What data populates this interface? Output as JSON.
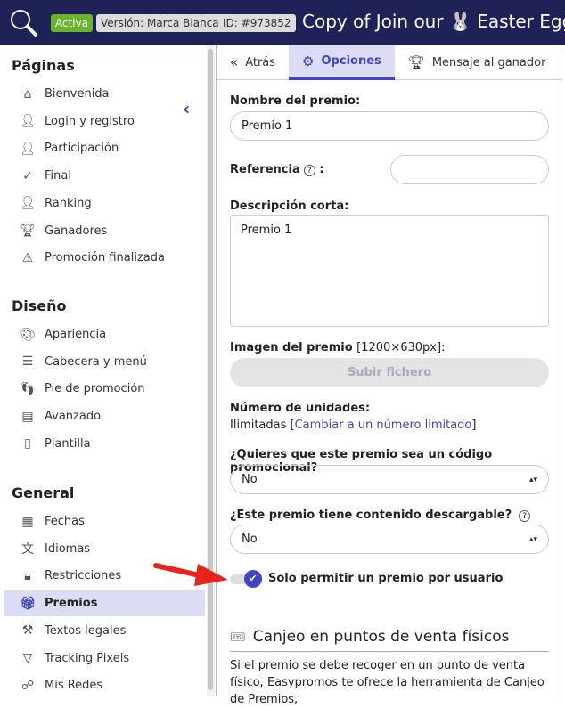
{
  "header": {
    "status": "Activa",
    "version_label": "Versión:",
    "version": "Marca Blanca",
    "id_label": "ID:",
    "id": "#973852",
    "title": "Copy of Join our 🐰 Easter Egg",
    "bg": "#1f2257"
  },
  "sidebar": {
    "sections": [
      {
        "title": "Páginas",
        "items": [
          {
            "label": "Bienvenida",
            "icon": "home-icon"
          },
          {
            "label": "Login y registro",
            "icon": "user-gear-icon"
          },
          {
            "label": "Participación",
            "icon": "user-plus-icon"
          },
          {
            "label": "Final",
            "icon": "check-icon"
          },
          {
            "label": "Ranking",
            "icon": "ranking-icon"
          },
          {
            "label": "Ganadores",
            "icon": "trophy-icon"
          },
          {
            "label": "Promoción finalizada",
            "icon": "warning-icon"
          }
        ]
      },
      {
        "title": "Diseño",
        "items": [
          {
            "label": "Apariencia",
            "icon": "palette-icon"
          },
          {
            "label": "Cabecera y menú",
            "icon": "menu-icon"
          },
          {
            "label": "Pie de promoción",
            "icon": "footprint-icon"
          },
          {
            "label": "Avanzado",
            "icon": "code-icon"
          },
          {
            "label": "Plantilla",
            "icon": "file-icon"
          }
        ]
      },
      {
        "title": "General",
        "items": [
          {
            "label": "Fechas",
            "icon": "calendar-icon"
          },
          {
            "label": "Idiomas",
            "icon": "language-icon"
          },
          {
            "label": "Restricciones",
            "icon": "lock-icon"
          },
          {
            "label": "Premios",
            "icon": "gift-icon",
            "active": true
          },
          {
            "label": "Textos legales",
            "icon": "gavel-icon"
          },
          {
            "label": "Tracking Pixels",
            "icon": "filter-icon"
          },
          {
            "label": "Mis Redes",
            "icon": "network-icon"
          }
        ]
      }
    ]
  },
  "tabs": [
    {
      "label": "Atrás",
      "icon": "double-chevron-left-icon"
    },
    {
      "label": "Opciones",
      "icon": "gear-icon",
      "active": true
    },
    {
      "label": "Mensaje al ganador",
      "icon": "trophy-icon"
    }
  ],
  "form": {
    "name_label": "Nombre del premio:",
    "name_value": "Premio 1",
    "ref_label": "Referencia",
    "ref_value": "",
    "desc_label": "Descripción corta:",
    "desc_value": "Premio 1",
    "image_label": "Imagen del premio",
    "image_size": "[1200×630px]:",
    "upload_label": "Subir fichero",
    "units_label": "Número de unidades:",
    "units_value": "Ilimitadas",
    "units_link": "Cambiar a un número limitado",
    "promo_label": "¿Quieres que este premio sea un código promocional?",
    "promo_value": "No",
    "download_label": "¿Este premio tiene contenido descargable?",
    "download_value": "No",
    "toggle_label": "Solo permitir un premio por usuario",
    "toggle_on": true,
    "section_title": "Canjeo en puntos de venta físicos",
    "section_text": "Si el premio se debe recoger en un punto de venta físico, Easypromos te ofrece la herramienta de Canjeo de Premios,"
  },
  "colors": {
    "accent": "#3f45c2",
    "active_bg": "#dcdcf5",
    "status_green": "#6ab42d",
    "arrow": "#e8231c"
  }
}
